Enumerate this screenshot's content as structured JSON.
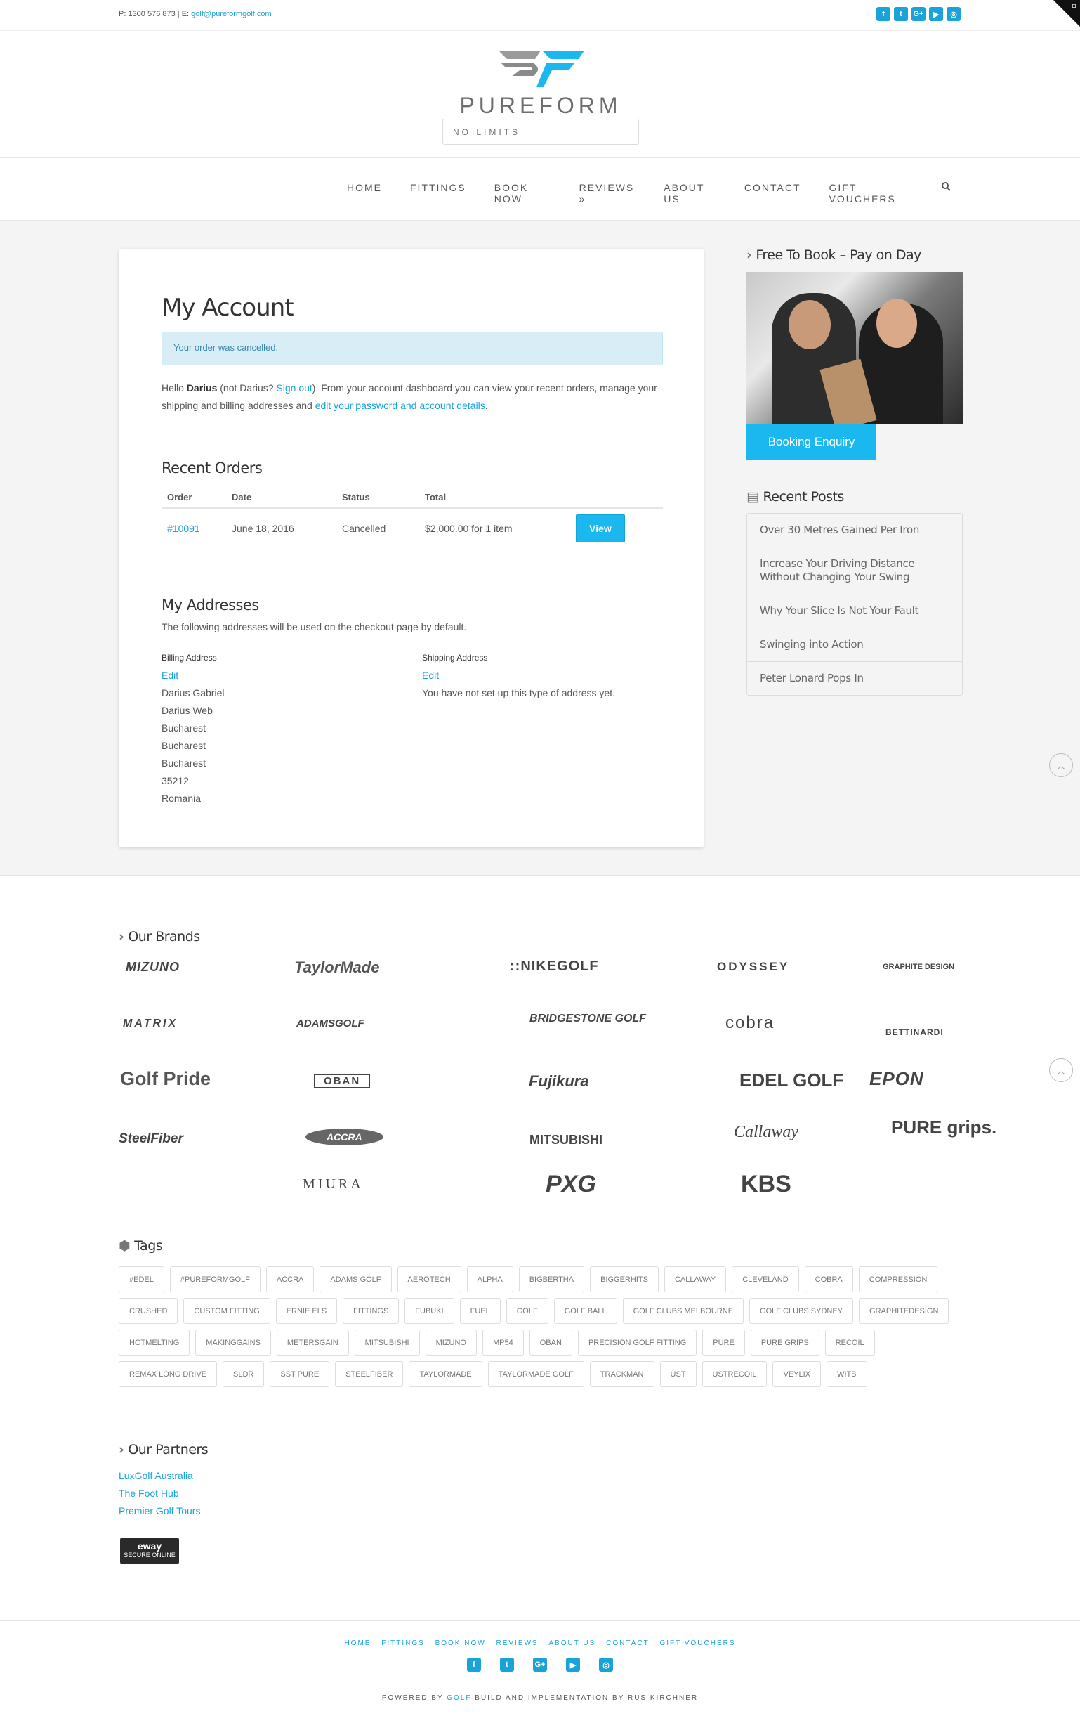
{
  "topbar": {
    "contact_prefix": "P: 1300 576 873 | E: ",
    "email": "golf@pureformgolf.com",
    "social": [
      "f",
      "t",
      "G+",
      "▶",
      "◎"
    ]
  },
  "logo": {
    "brand": "PUREFORM",
    "tagline": "NO LIMITS"
  },
  "nav": {
    "items": [
      "HOME",
      "FITTINGS",
      "BOOK NOW",
      "REVIEWS »",
      "ABOUT US",
      "CONTACT",
      "GIFT VOUCHERS"
    ],
    "search_icon": "search-icon"
  },
  "account": {
    "title": "My Account",
    "notice": "Your order was cancelled.",
    "hello_1": "Hello ",
    "hello_name": "Darius",
    "hello_2": " (not Darius? ",
    "signout": "Sign out",
    "hello_3": "). From your account dashboard you can view your recent orders, manage your shipping and billing addresses and ",
    "edit_link": "edit your password and account details",
    "hello_4": "."
  },
  "orders": {
    "title": "Recent Orders",
    "headers": [
      "Order",
      "Date",
      "Status",
      "Total"
    ],
    "rows": [
      {
        "order": "#10091",
        "date": "June 18, 2016",
        "status": "Cancelled",
        "total": "$2,000.00 for 1 item",
        "action": "View"
      }
    ]
  },
  "addresses": {
    "title": "My Addresses",
    "intro": "The following addresses will be used on the checkout page by default.",
    "billing": {
      "title": "Billing Address",
      "edit": "Edit",
      "lines": [
        "Darius Gabriel",
        "Darius Web",
        "Bucharest",
        "Bucharest",
        "Bucharest",
        "35212",
        "Romania"
      ]
    },
    "shipping": {
      "title": "Shipping Address",
      "edit": "Edit",
      "text": "You have not set up this type of address yet."
    }
  },
  "sidebar": {
    "book_title": "Free To Book – Pay on Day",
    "booking_button": "Booking Enquiry",
    "posts_title": "Recent Posts",
    "posts": [
      "Over 30 Metres Gained Per Iron",
      "Increase Your Driving Distance Without Changing Your Swing",
      "Why Your Slice Is Not Your Fault",
      "Swinging into Action",
      "Peter Lonard Pops In"
    ]
  },
  "brands": {
    "title": "Our Brands",
    "logos": [
      "MIZUNO",
      "TaylorMade",
      "::NIKEGOLF",
      "ODYSSEY",
      "GRAPHITE DESIGN",
      "MATRIX",
      "ADAMSGOLF",
      "BRIDGESTONE GOLF",
      "cobra",
      "BETTINARDI",
      "Golf Pride",
      "OBAN",
      "Fujikura",
      "EDEL GOLF",
      "EPON",
      "SteelFiber",
      "ACCRA",
      "MITSUBISHI",
      "Callaway",
      "PURE grips.",
      "MIURA",
      "PXG",
      "KBS"
    ]
  },
  "tags": {
    "title": "Tags",
    "items": [
      "#EDEL",
      "#PUREFORMGOLF",
      "ACCRA",
      "ADAMS GOLF",
      "AEROTECH",
      "ALPHA",
      "BIGBERTHA",
      "BIGGERHITS",
      "CALLAWAY",
      "CLEVELAND",
      "COBRA",
      "COMPRESSION",
      "CRUSHED",
      "CUSTOM FITTING",
      "ERNIE ELS",
      "FITTINGS",
      "FUBUKI",
      "FUEL",
      "GOLF",
      "GOLF BALL",
      "GOLF CLUBS MELBOURNE",
      "GOLF CLUBS SYDNEY",
      "GRAPHITEDESIGN",
      "HOTMELTING",
      "MAKINGGAINS",
      "METERSGAIN",
      "MITSUBISHI",
      "MIZUNO",
      "MP54",
      "OBAN",
      "PRECISION GOLF FITTING",
      "PURE",
      "PURE GRIPS",
      "RECOIL",
      "REMAX LONG DRIVE",
      "SLDR",
      "SST PURE",
      "STEELFIBER",
      "TAYLORMADE",
      "TAYLORMADE GOLF",
      "TRACKMAN",
      "UST",
      "USTRECOIL",
      "VEYLIX",
      "WITB"
    ]
  },
  "partners": {
    "title": "Our Partners",
    "items": [
      "LuxGolf Australia",
      "The Foot Hub",
      "Premier Golf Tours"
    ]
  },
  "eway": {
    "brand": "eway",
    "label": "SECURE ONLINE"
  },
  "footer": {
    "nav": [
      "HOME",
      "FITTINGS",
      "BOOK NOW",
      "REVIEWS",
      "ABOUT US",
      "CONTACT",
      "GIFT VOUCHERS"
    ],
    "powered_1": "POWERED BY ",
    "powered_link": "GOLF",
    "powered_2": " BUILD AND IMPLEMENTATION BY RUS KIRCHNER"
  },
  "colors": {
    "accent": "#1ab8ee",
    "link": "#1aa3d9",
    "notice_bg": "#d9edf7"
  }
}
